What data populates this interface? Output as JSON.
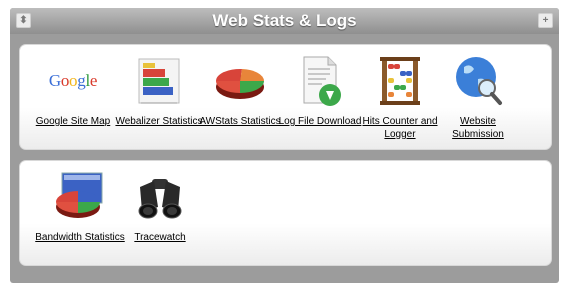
{
  "header": {
    "title": "Web Stats & Logs",
    "collapse_icon": "up-down-arrows-icon",
    "add_icon": "plus-icon"
  },
  "sections": [
    {
      "items": [
        {
          "label": "Google Site Map",
          "icon": "google-logo-icon"
        },
        {
          "label": "Webalizer Statistics",
          "icon": "bar-chart-icon"
        },
        {
          "label": "AWStats Statistics",
          "icon": "pie-chart-icon"
        },
        {
          "label": "Log File Download",
          "icon": "log-file-download-icon"
        },
        {
          "label": "Hits Counter and Logger",
          "icon": "abacus-icon"
        },
        {
          "label": "Website Submission",
          "icon": "globe-magnifier-icon"
        }
      ]
    },
    {
      "items": [
        {
          "label": "Bandwidth Statistics",
          "icon": "bandwidth-chart-icon"
        },
        {
          "label": "Tracewatch",
          "icon": "binoculars-icon"
        }
      ]
    }
  ],
  "google_letters": [
    {
      "ch": "G",
      "color": "#3b6fd8"
    },
    {
      "ch": "o",
      "color": "#d93a2b"
    },
    {
      "ch": "o",
      "color": "#f2b51a"
    },
    {
      "ch": "g",
      "color": "#3b6fd8"
    },
    {
      "ch": "l",
      "color": "#2f9a3e"
    },
    {
      "ch": "e",
      "color": "#d93a2b"
    }
  ]
}
